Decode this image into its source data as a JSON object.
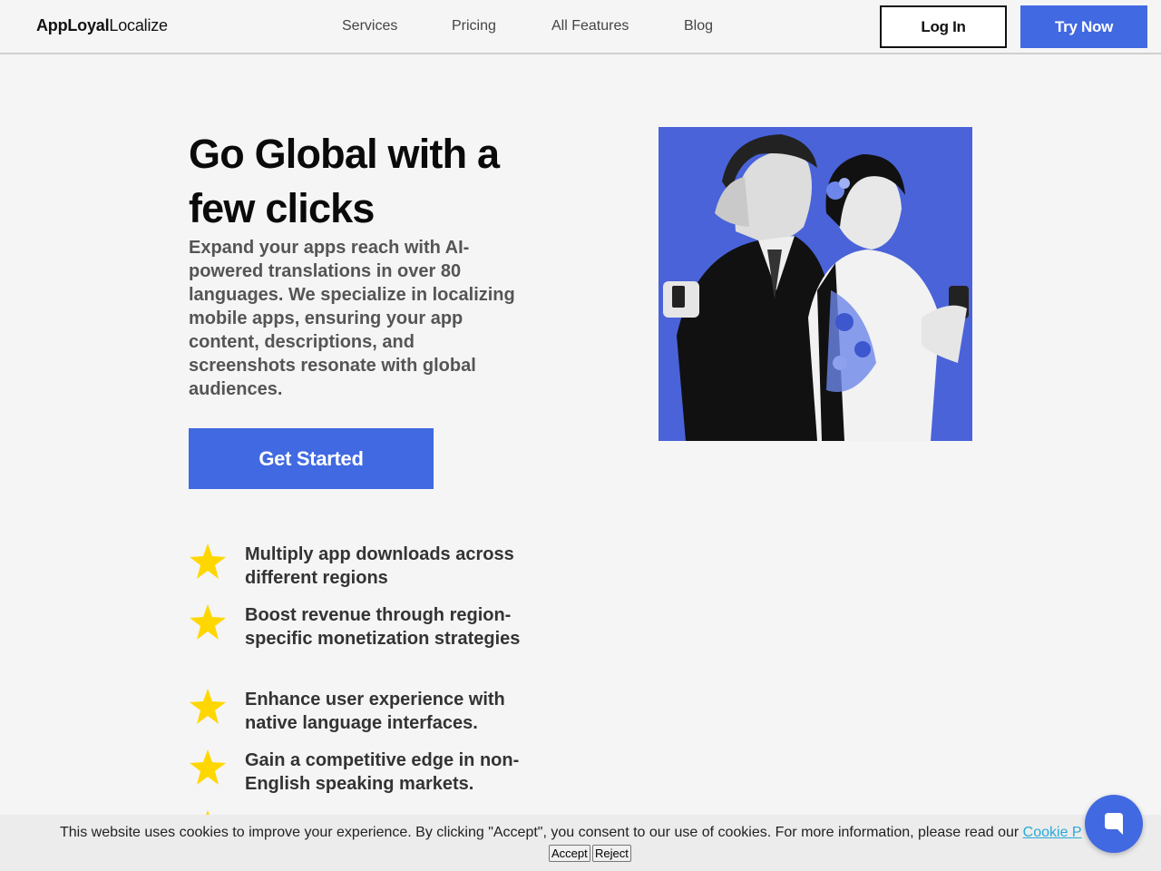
{
  "brand": {
    "bold": "AppLoyal",
    "light": "Localize"
  },
  "nav": [
    "Services",
    "Pricing",
    "All Features",
    "Blog"
  ],
  "header": {
    "login_label": "Log In",
    "try_label": "Try Now"
  },
  "hero": {
    "title": "Go Global with a few clicks",
    "description": "Expand your apps reach with AI-powered translations in over 80 languages. We specialize in localizing mobile apps, ensuring your app content, descriptions, and screenshots resonate with global audiences.",
    "cta_label": "Get Started",
    "image_icon": "couple-with-phones-illustration"
  },
  "features": [
    "Multiply app downloads across different regions",
    "Boost revenue through region-specific monetization strategies",
    "Enhance user experience with native language interfaces.",
    "Gain a competitive edge in non-English speaking markets."
  ],
  "feature_icon": "star-icon",
  "cookie": {
    "text": "This website uses cookies to improve your experience. By clicking \"Accept\", you consent to our use of cookies. For more information, please read our",
    "link_text": "Cookie P",
    "accept_label": "Accept",
    "reject_label": "Reject"
  },
  "colors": {
    "accent": "#4169e1",
    "star": "#ffd700",
    "background": "#f5f5f5"
  }
}
